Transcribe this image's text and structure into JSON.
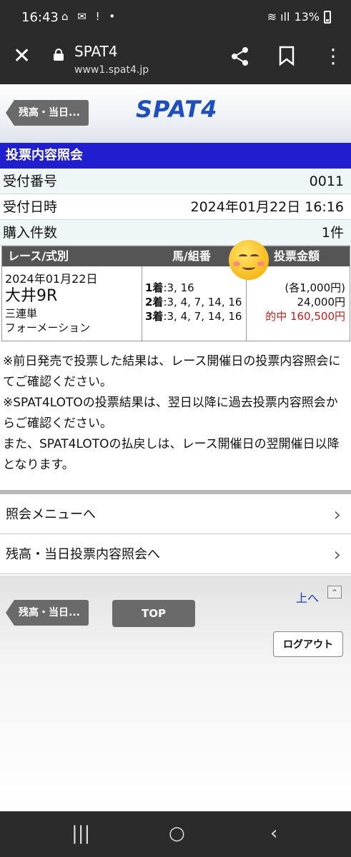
{
  "status_bar": {
    "time": "16:43",
    "notif_icons": "⌂ ✉ ! •",
    "signal": "📶",
    "battery_pct": "13%"
  },
  "browser": {
    "close_glyph": "✕",
    "title": "SPAT4",
    "url": "www1.spat4.jp",
    "share_glyph": "⋲",
    "bookmark_glyph": "⚑",
    "menu_glyph": "⋮"
  },
  "header": {
    "back_label": "残高・当日...",
    "logo": "SPAT4"
  },
  "section_title": "投票内容照会",
  "info": {
    "receipt_no_label": "受付番号",
    "receipt_no": "0011",
    "datetime_label": "受付日時",
    "datetime": "2024年01月22日 16:16",
    "count_label": "購入件数",
    "count": "1件"
  },
  "race_table": {
    "headers": [
      "レース/式別",
      "馬/組番",
      "投票金額"
    ],
    "date": "2024年01月22日",
    "race": "大井9R",
    "bet_type": "三連単",
    "bet_method": "フォーメーション",
    "picks": [
      {
        "pos": "1着",
        "horses": ":3, 16"
      },
      {
        "pos": "2着",
        "horses": ":3, 4, 7, 14, 16"
      },
      {
        "pos": "3着",
        "horses": ":3, 4, 7, 14, 16"
      }
    ],
    "unit_amount": "(各1,000円)",
    "total_amount": "24,000円",
    "payout": "的中 160,500円"
  },
  "notes": [
    "※前日発売で投票した結果は、レース開催日の投票内容照会にてご確認ください。",
    "※SPAT4LOTOの投票結果は、翌日以降に過去投票内容照会からご確認ください。",
    "また、SPAT4LOTOの払戻しは、レース開催日の翌開催日以降となります。"
  ],
  "menu": {
    "inquiry_menu": "照会メニューへ",
    "balance_inquiry": "残高・当日投票内容照会へ",
    "chevron": "›"
  },
  "footer": {
    "up_link": "上へ",
    "up_icon": "⌃",
    "back_label": "残高・当日...",
    "top_label": "TOP",
    "logout_label": "ログアウト"
  },
  "nav": {
    "recents": "|||",
    "home": "○",
    "back": "‹"
  }
}
